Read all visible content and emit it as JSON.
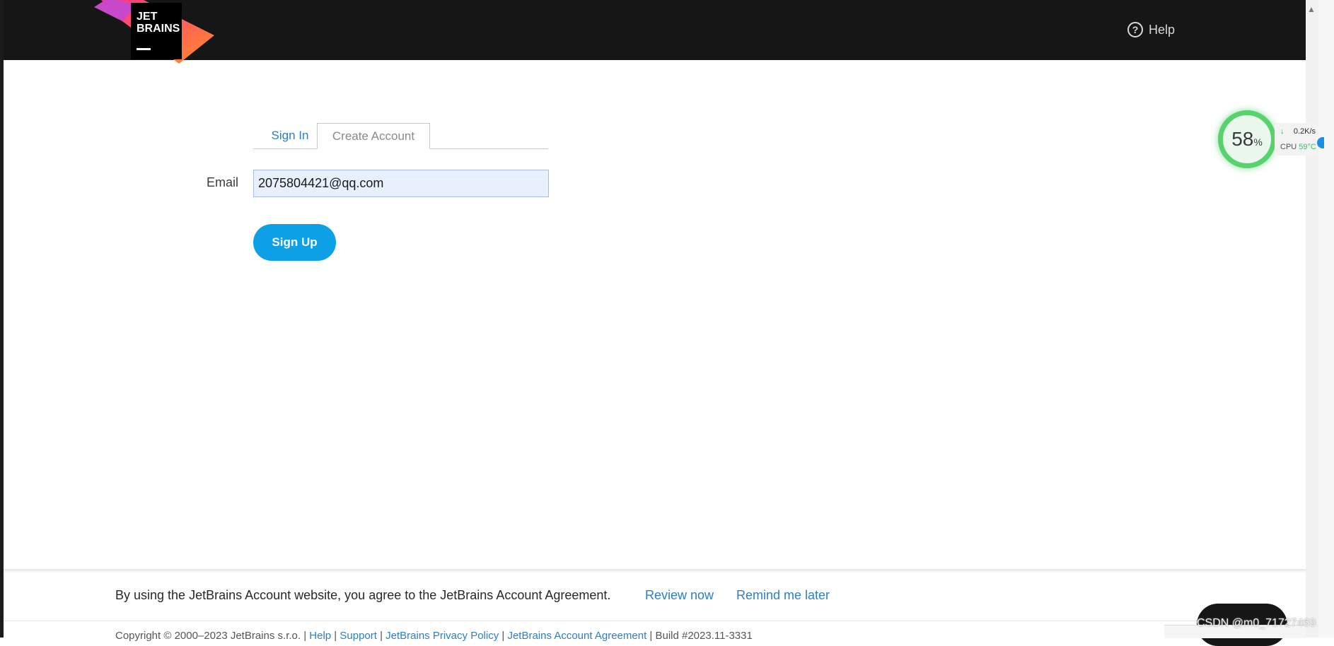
{
  "header": {
    "logo_line1": "JET",
    "logo_line2": "BRAINS",
    "help_label": "Help"
  },
  "tabs": {
    "signin_label": "Sign In",
    "create_label": "Create Account"
  },
  "form": {
    "email_label": "Email",
    "email_value": "2075804421@qq.com",
    "signup_label": "Sign Up"
  },
  "cpu_widget": {
    "percent": "58",
    "percent_unit": "%",
    "net_speed": "0.2K/s",
    "cpu_label": "CPU",
    "cpu_temp": "59°C"
  },
  "footer": {
    "agreement_text": "By using the JetBrains Account website, you agree to the JetBrains Account Agreement.",
    "review_label": "Review now",
    "remind_label": "Remind me later",
    "copyright_prefix": "Copyright © 2000–2023 JetBrains s.r.o. |",
    "links": [
      "Help",
      "Support",
      "JetBrains Privacy Policy",
      "JetBrains Account Agreement"
    ],
    "build": "| Build #2023.11-3331",
    "watermark": "CSDN @m0_71727469"
  }
}
